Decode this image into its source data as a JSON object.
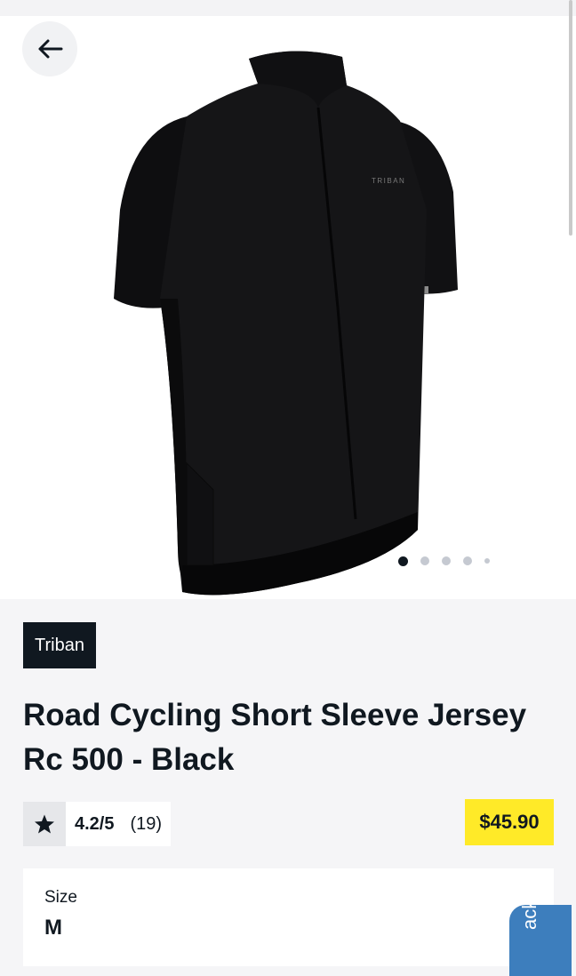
{
  "header": {
    "back_icon": "arrow-left-icon"
  },
  "product": {
    "image_text": "TRIBAN",
    "brand": "Triban",
    "title": "Road Cycling Short Sleeve Jersey Rc 500 - Black",
    "rating": {
      "score": "4.2/5",
      "count": "(19)",
      "icon": "star-icon"
    },
    "price": "$45.90",
    "carousel": {
      "total": 5,
      "active": 1
    }
  },
  "options": {
    "size_label": "Size",
    "size_value": "M"
  },
  "feedback": {
    "label": "Feedback",
    "visible_text": "ack"
  },
  "colors": {
    "price_bg": "#ffea28",
    "brand_bg": "#101820",
    "feedback_bg": "#3d7ebd"
  }
}
